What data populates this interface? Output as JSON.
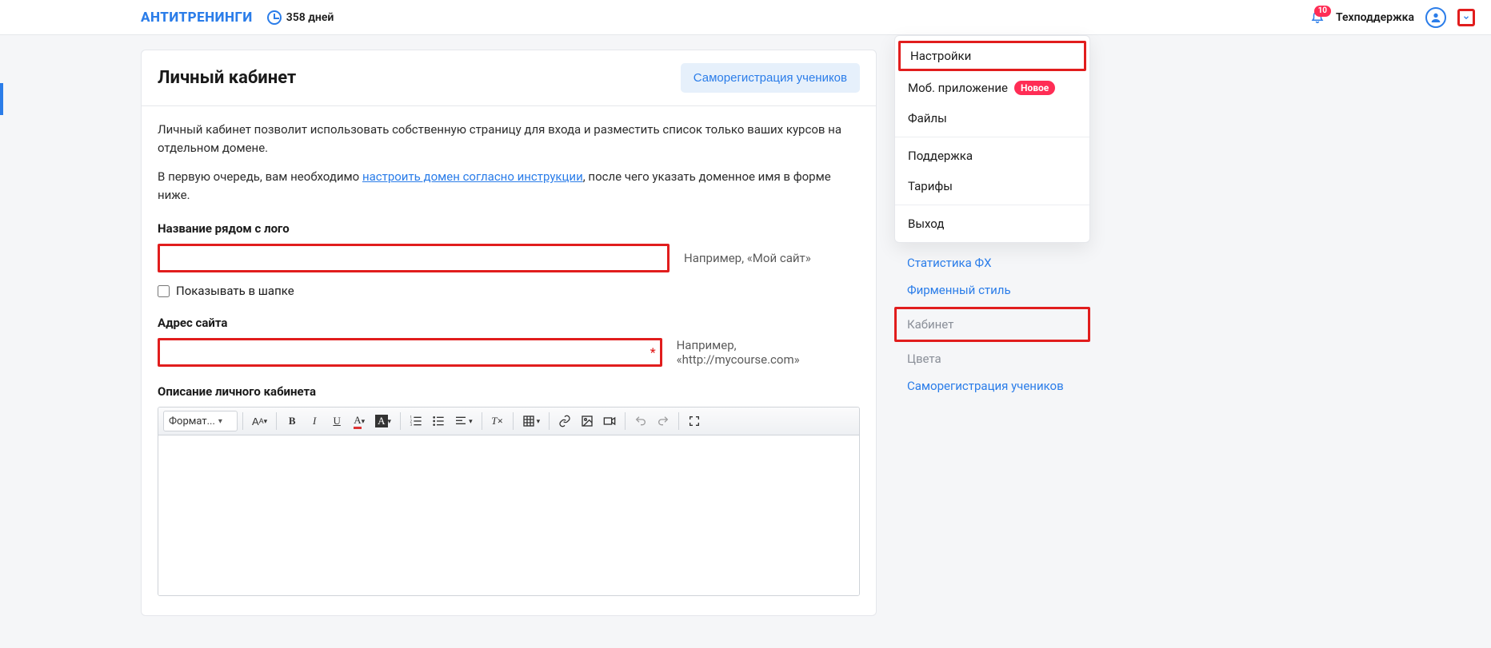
{
  "header": {
    "logo": "АНТИТРЕНИНГИ",
    "days_label": "358 дней",
    "notifications_count": "10",
    "user_label": "Техподдержка"
  },
  "dropdown": {
    "settings": "Настройки",
    "mobile_app": "Моб. приложение",
    "mobile_badge": "Новое",
    "files": "Файлы",
    "support": "Поддержка",
    "tariffs": "Тарифы",
    "logout": "Выход"
  },
  "sidenav": {
    "stats": "Статистика ФХ",
    "brand_style": "Фирменный стиль",
    "cabinet": "Кабинет",
    "colors": "Цвета",
    "selfreg": "Саморегистрация учеников"
  },
  "panel": {
    "title": "Личный кабинет",
    "selfreg_btn": "Саморегистрация учеников",
    "intro": "Личный кабинет позволит использовать собственную страницу для входа и разместить список только ваших курсов на отдельном домене.",
    "setup_prefix": "В первую очередь, вам необходимо ",
    "setup_link": "настроить домен согласно инструкции",
    "setup_suffix": ", после чего указать доменное имя в форме ниже.",
    "label_name": "Название рядом с лого",
    "hint_name": "Например, «Мой сайт»",
    "checkbox_show": "Показывать в шапке",
    "label_url": "Адрес сайта",
    "hint_url": "Например, «http://mycourse.com»",
    "label_desc": "Описание личного кабинета"
  },
  "editor": {
    "format_label": "Формат..."
  }
}
